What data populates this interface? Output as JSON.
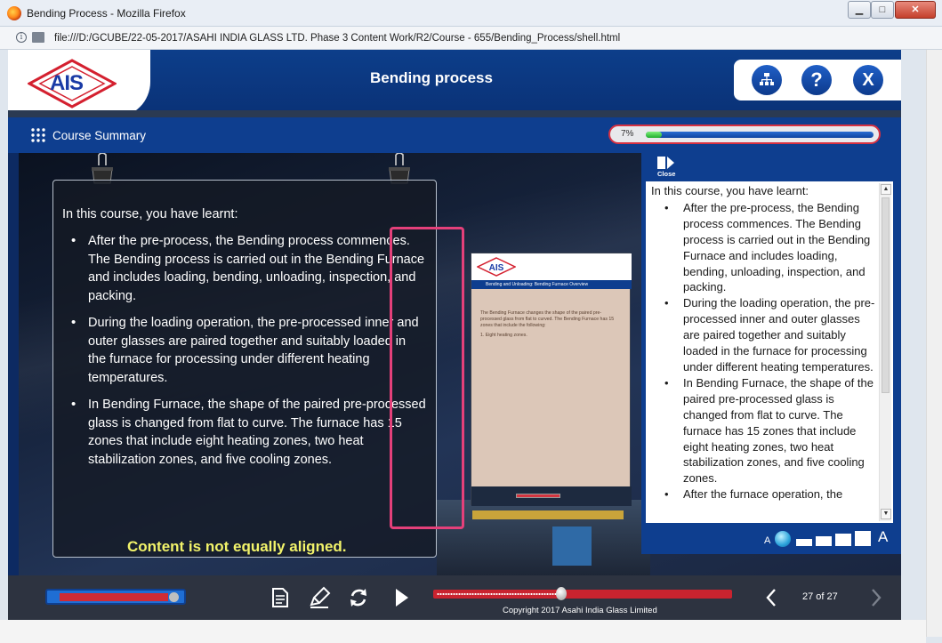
{
  "browser": {
    "window_title": "Bending Process - Mozilla Firefox",
    "url": "file:///D:/GCUBE/22-05-2017/ASAHI INDIA GLASS LTD. Phase 3 Content Work/R2/Course - 655/Bending_Process/shell.html",
    "buttons": {
      "minimize": "▁",
      "maximize": "□",
      "close": "✕"
    }
  },
  "header": {
    "logo": "AIS",
    "title": "Bending process",
    "buttons": {
      "map": "sitemap-icon",
      "help": "?",
      "exit": "X"
    }
  },
  "subheader": {
    "course_summary_label": "Course Summary",
    "progress": {
      "label": "7%",
      "fraction": 0.07
    }
  },
  "board": {
    "intro": "In this course, you have learnt:",
    "items": [
      "After the pre-process, the Bending process commences. The Bending process is carried out in the Bending Furnace and includes loading, bending, unloading, inspection, and packing.",
      "During the loading operation, the pre-processed inner and outer glasses are paired together and suitably loaded in the furnace for processing under different heating temperatures.",
      "In Bending Furnace, the shape of the paired pre-processed glass is changed from flat to curve. The furnace has 15 zones that include eight heating zones, two heat stabilization zones, and five cooling zones."
    ],
    "annotation": "Content is not equally aligned."
  },
  "thumbnail": {
    "logo": "AIS",
    "bar_title": "Bending and Unloading: Bending Furnace Overview",
    "body": "The Bending Furnace changes the shape of the paired pre-processed glass from flat to curved. The Bending Furnace has 15 zones that include the following:",
    "item": "1.  Eight heating zones."
  },
  "panel": {
    "close_label": "Close",
    "intro": "In this course, you have learnt:",
    "items": [
      "After the pre-process, the Bending process commences. The Bending process is carried out in the Bending Furnace and includes loading, bending, unloading, inspection, and packing.",
      "During the loading operation, the pre-processed inner and outer glasses are paired together and suitably loaded in the furnace for processing under different heating temperatures.",
      "In Bending Furnace, the shape of the paired pre-processed glass is changed from flat to curve. The furnace has 15 zones that include eight heating zones, two heat stabilization zones, and five cooling zones.",
      "After the furnace operation, the"
    ],
    "font_small": "A",
    "font_large": "A"
  },
  "footer": {
    "copyright": "Copyright 2017 Asahi India Glass Limited",
    "page": "27 of 27",
    "seek_fraction": 0.43
  },
  "colors": {
    "brand_blue": "#0e3e8f",
    "logo_red": "#d4202f",
    "annotation_pink": "#e4407a",
    "annotation_text": "#f2f36a",
    "progress_green": "#1fae2c"
  }
}
